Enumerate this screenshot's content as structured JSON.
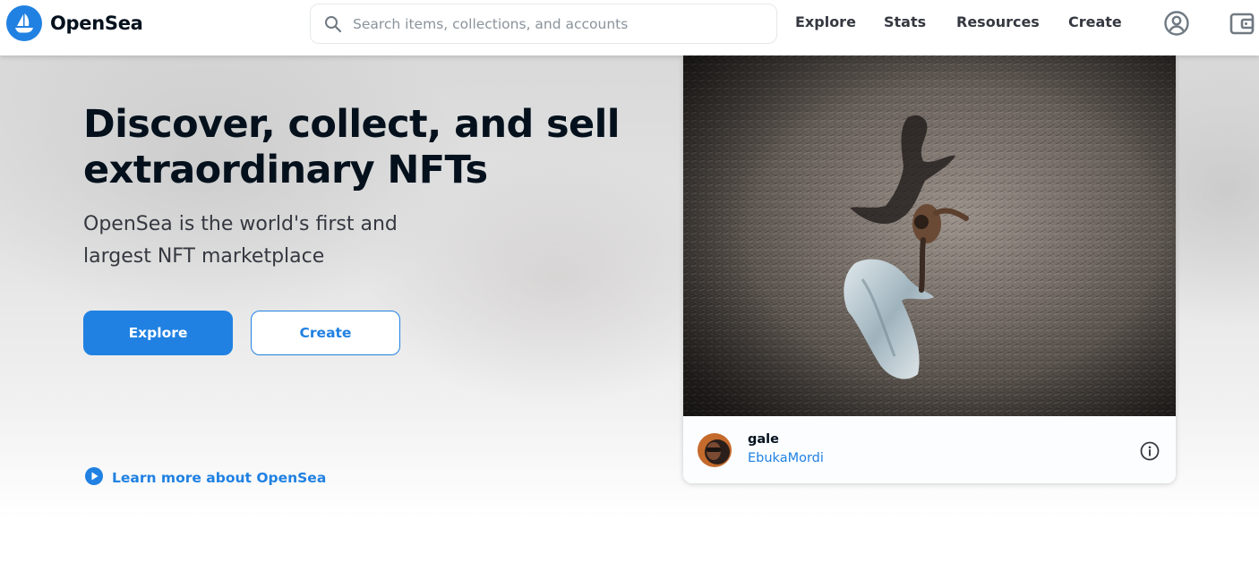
{
  "brand": {
    "name": "OpenSea",
    "accent_color": "#2081e2",
    "logo_icon": "opensea-ship-icon"
  },
  "search": {
    "placeholder": "Search items, collections, and accounts",
    "value": ""
  },
  "nav": {
    "items": [
      {
        "label": "Explore"
      },
      {
        "label": "Stats"
      },
      {
        "label": "Resources"
      },
      {
        "label": "Create"
      }
    ],
    "icons": [
      "profile-icon",
      "wallet-icon"
    ]
  },
  "hero": {
    "title": "Discover, collect, and sell extraordinary NFTs",
    "subtitle": "OpenSea is the world's first and largest NFT marketplace",
    "explore_button": "Explore",
    "create_button": "Create",
    "learn_more": "Learn more about OpenSea"
  },
  "featured": {
    "item_name": "gale",
    "creator": "EbukaMordi"
  }
}
